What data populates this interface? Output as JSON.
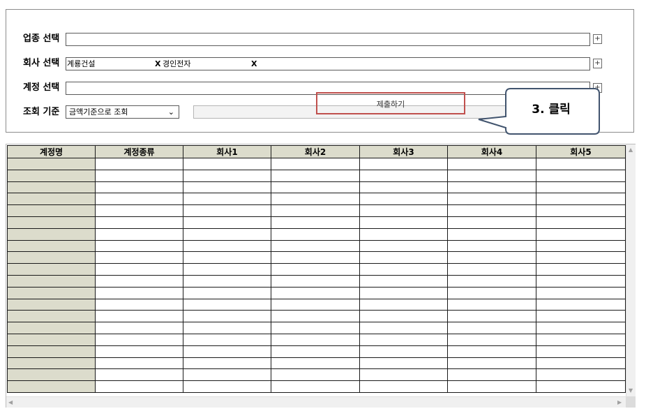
{
  "form": {
    "industry_label": "업종 선택",
    "company_label": "회사 선택",
    "account_label": "계정 선택",
    "query_label": "조회 기준",
    "plus_symbol": "+",
    "chips": [
      {
        "name": "계룡건설",
        "remove": "X"
      },
      {
        "name": "경인전자",
        "remove": "X"
      }
    ],
    "query_select_value": "금액기준으로 조회",
    "select_chevron": "⌄",
    "submit_label": "제출하기"
  },
  "callout": {
    "text": "3. 클릭",
    "border_color": "#41546e",
    "highlight_color": "#c0504d"
  },
  "grid": {
    "columns": [
      "계정명",
      "계정종류",
      "회사1",
      "회사2",
      "회사3",
      "회사4",
      "회사5"
    ],
    "header_color": "#dcdccc",
    "row_count": 20
  },
  "scrollbar": {
    "up_icon": "▲",
    "down_icon": "▼",
    "left_icon": "◀",
    "right_icon": "▶"
  }
}
